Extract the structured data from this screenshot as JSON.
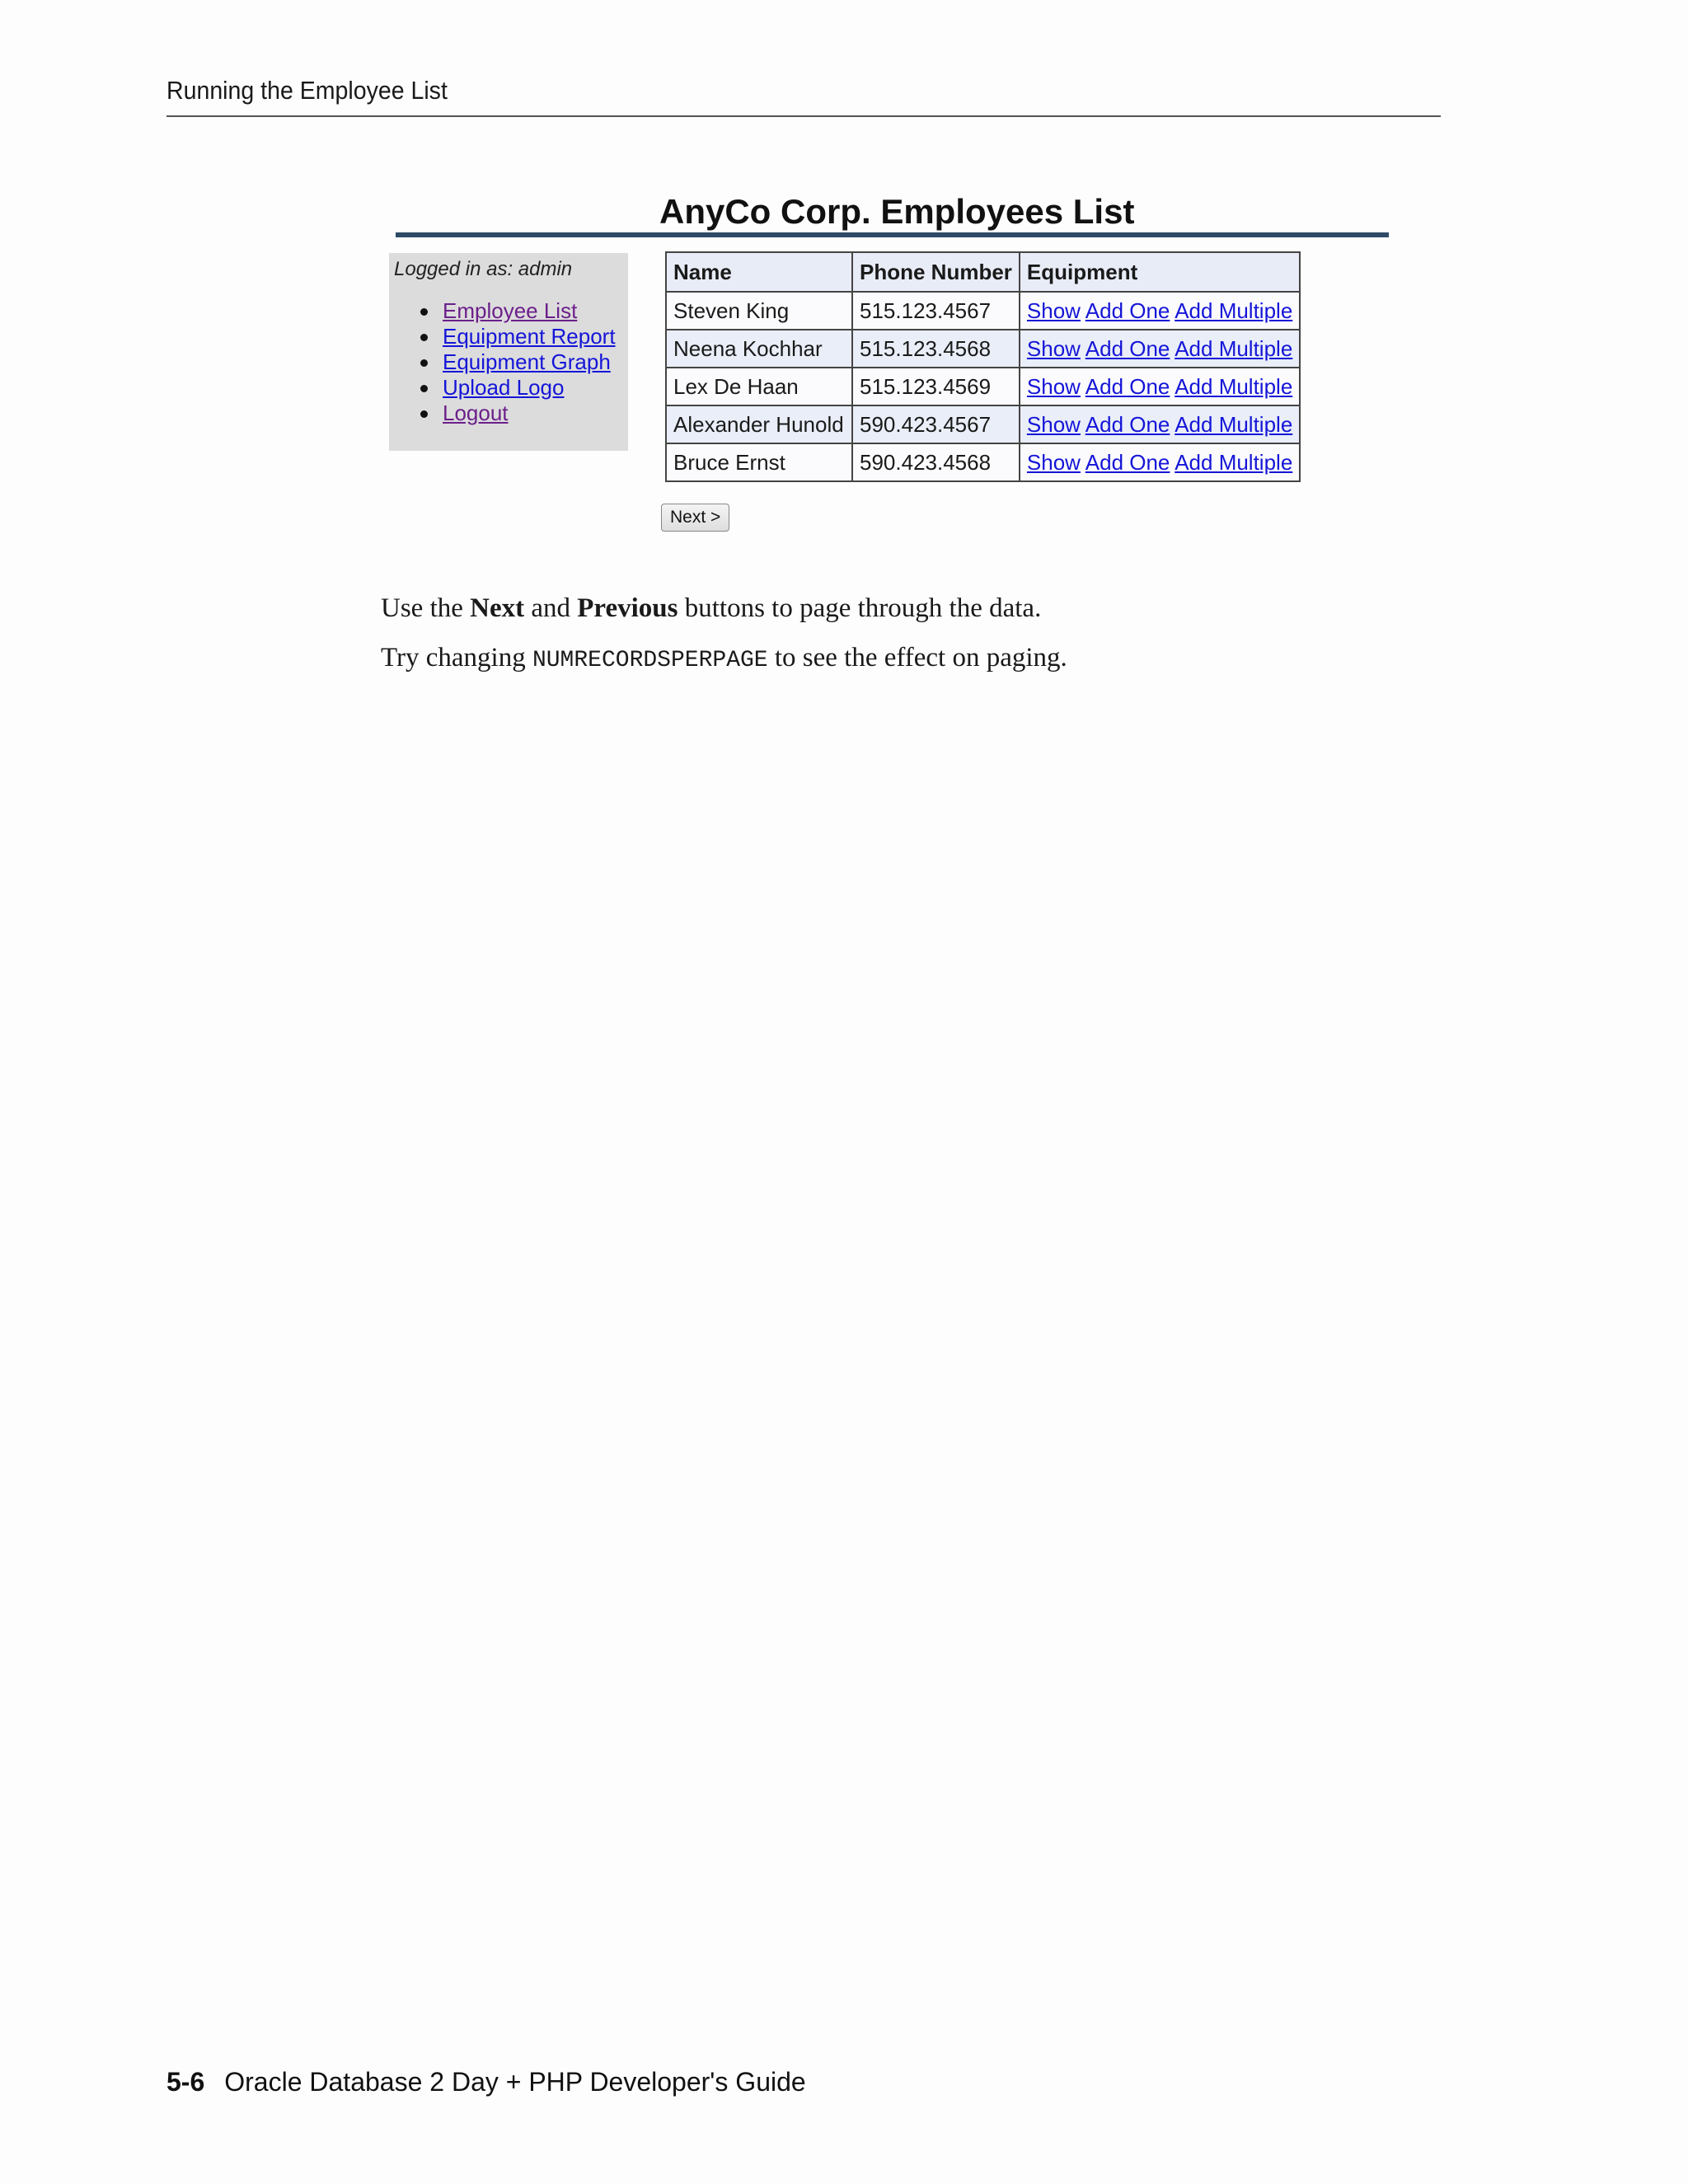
{
  "header": {
    "running_head": "Running the Employee List"
  },
  "app": {
    "title": "AnyCo Corp. Employees List",
    "logged_in": "Logged in as: admin",
    "nav": [
      {
        "label": "Employee List"
      },
      {
        "label": "Equipment Report"
      },
      {
        "label": "Equipment Graph"
      },
      {
        "label": "Upload Logo"
      },
      {
        "label": "Logout"
      }
    ],
    "table": {
      "columns": [
        "Name",
        "Phone Number",
        "Equipment"
      ],
      "rows": [
        {
          "name": "Steven King",
          "phone": "515.123.4567"
        },
        {
          "name": "Neena Kochhar",
          "phone": "515.123.4568"
        },
        {
          "name": "Lex De Haan",
          "phone": "515.123.4569"
        },
        {
          "name": "Alexander Hunold",
          "phone": "590.423.4567"
        },
        {
          "name": "Bruce Ernst",
          "phone": "590.423.4568"
        }
      ],
      "actions": {
        "show": "Show",
        "add_one": "Add One",
        "add_multiple": "Add Multiple"
      }
    },
    "next_button": "Next >"
  },
  "body": {
    "p1": {
      "a": "Use the ",
      "b1": "Next",
      "c": " and ",
      "b2": "Previous",
      "d": " buttons to page through the data."
    },
    "p2": {
      "a": "Try changing ",
      "code": "NUMRECORDSPERPAGE",
      "b": " to see the effect on paging."
    }
  },
  "footer": {
    "page_number": "5-6",
    "book_title": "Oracle Database 2 Day + PHP Developer's Guide"
  }
}
